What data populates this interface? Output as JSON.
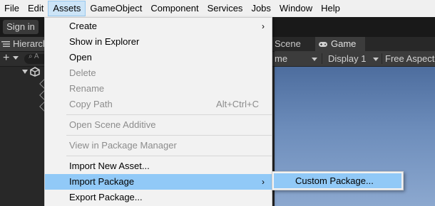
{
  "menubar": {
    "items": [
      "File",
      "Edit",
      "Assets",
      "GameObject",
      "Component",
      "Services",
      "Jobs",
      "Window",
      "Help"
    ],
    "open_item": "Assets"
  },
  "toolbar": {
    "signin_label": "Sign in"
  },
  "hierarchy": {
    "tab_label": "Hierarch",
    "search_placeholder": "A"
  },
  "view_tabs": {
    "scene_label": "Scene",
    "game_label": "Game"
  },
  "game_toolbar": {
    "mode_label": "me",
    "display_label": "Display 1",
    "aspect_label": "Free Aspect"
  },
  "assets_menu": {
    "create": "Create",
    "show_in_explorer": "Show in Explorer",
    "open": "Open",
    "delete": "Delete",
    "rename": "Rename",
    "copy_path": "Copy Path",
    "copy_path_shortcut": "Alt+Ctrl+C",
    "open_scene_additive": "Open Scene Additive",
    "view_in_package_manager": "View in Package Manager",
    "import_new_asset": "Import New Asset...",
    "import_package": "Import Package",
    "export_package": "Export Package..."
  },
  "import_package_submenu": {
    "custom_package": "Custom Package..."
  },
  "colors": {
    "menu_bg": "#f2f2f2",
    "menu_highlight": "#91c9f7",
    "menubar_open": "#cce4f7",
    "disabled_text": "#8c8c8c",
    "editor_dark": "#282828"
  }
}
